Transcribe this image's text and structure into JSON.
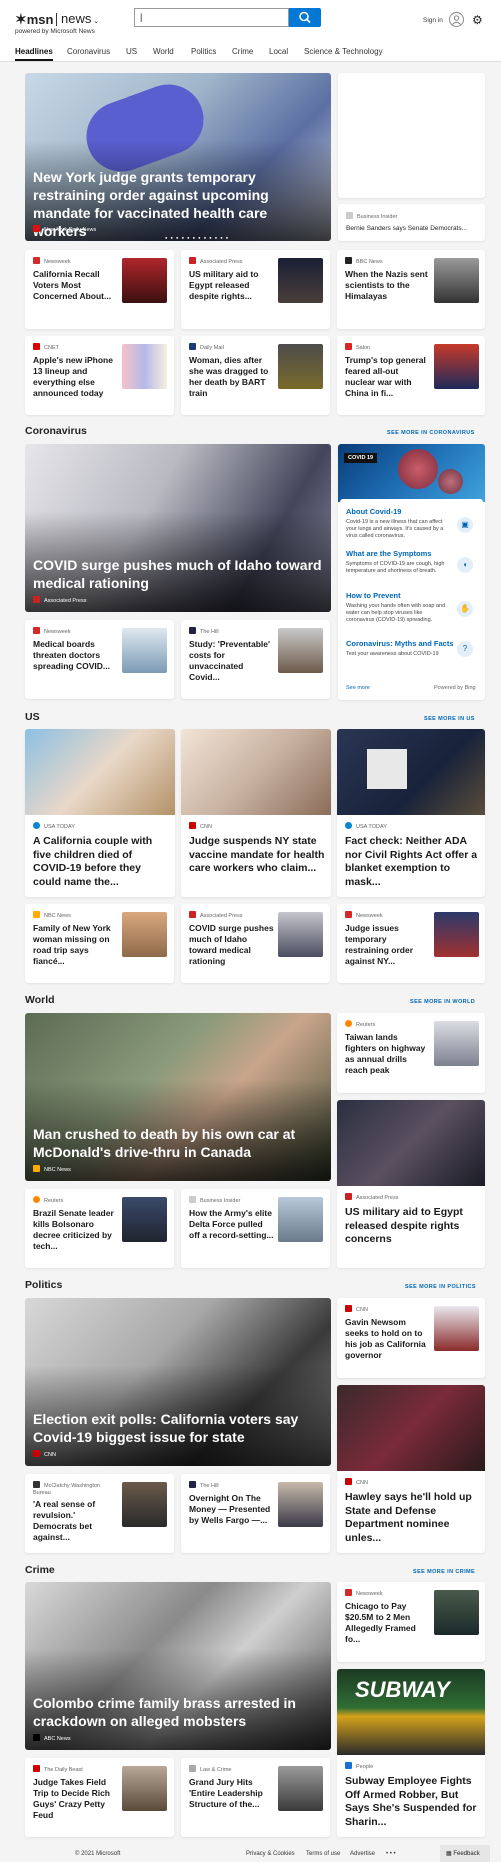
{
  "header": {
    "brand": "msn",
    "product": "news",
    "powered": "powered by Microsoft News",
    "search_value": "|",
    "signin": "Sign in"
  },
  "nav": [
    "Headlines",
    "Coronavirus",
    "US",
    "World",
    "Politics",
    "Crime",
    "Local",
    "Science & Technology"
  ],
  "headlines": {
    "hero": {
      "title": "New York judge grants temporary restraining order against upcoming mandate for vaccinated health care workers",
      "source": "New York Daily News"
    },
    "side": {
      "source": "Business Insider",
      "title": "Bernie Sanders says Senate Democrats..."
    },
    "cards": [
      {
        "source": "Newsweek",
        "title": "California Recall Voters Most Concerned About..."
      },
      {
        "source": "Associated Press",
        "title": "US military aid to Egypt released despite rights..."
      },
      {
        "source": "BBC News",
        "title": "When the Nazis sent scientists to the Himalayas"
      },
      {
        "source": "CNET",
        "title": "Apple's new iPhone 13 lineup and everything else announced today"
      },
      {
        "source": "Daily Mail",
        "title": "Woman, dies after she was dragged to her death by BART train"
      },
      {
        "source": "Salon",
        "title": "Trump's top general feared all-out nuclear war with China in fi..."
      }
    ]
  },
  "coronavirus": {
    "label": "Coronavirus",
    "more": "SEE MORE IN CORONAVIRUS",
    "hero": {
      "title": "COVID surge pushes much of Idaho toward medical rationing",
      "source": "Associated Press"
    },
    "panel": {
      "badge": "COVID 19",
      "items": [
        {
          "head": "About Covid-19",
          "text": "Covid-19 is a new illness that can affect your lungs and airways. It's caused by a virus called coronavirus."
        },
        {
          "head": "What are the Symptoms",
          "text": "Symptoms of COVID-19 are cough, high temperature and shortness of breath."
        },
        {
          "head": "How to Prevent",
          "text": "Washing your hands often with soap and water can help stop viruses like coronavirus (COVID-19) spreading."
        },
        {
          "head": "Coronavirus: Myths and Facts",
          "text": "Test your awareness about COVID-19"
        }
      ],
      "see_more": "See more",
      "powered": "Powered by Bing"
    },
    "cards": [
      {
        "source": "Newsweek",
        "title": "Medical boards threaten doctors spreading COVID..."
      },
      {
        "source": "The Hill",
        "title": "Study: 'Preventable' costs for unvaccinated Covid..."
      }
    ]
  },
  "us": {
    "label": "US",
    "more": "SEE MORE IN US",
    "tiles": [
      {
        "source": "USA TODAY",
        "title": "A California couple with five children died of COVID-19 before they could name the..."
      },
      {
        "source": "CNN",
        "title": "Judge suspends NY state vaccine mandate for health care workers who claim..."
      },
      {
        "source": "USA TODAY",
        "title": "Fact check: Neither ADA nor Civil Rights Act offer a blanket exemption to mask..."
      }
    ],
    "cards": [
      {
        "source": "NBC News",
        "title": "Family of New York woman missing on road trip says fiancé..."
      },
      {
        "source": "Associated Press",
        "title": "COVID surge pushes much of Idaho toward medical rationing"
      },
      {
        "source": "Newsweek",
        "title": "Judge issues temporary restraining order against NY..."
      }
    ]
  },
  "world": {
    "label": "World",
    "more": "SEE MORE IN WORLD",
    "hero": {
      "title": "Man crushed to death by his own car at McDonald's drive-thru in Canada",
      "source": "NBC News"
    },
    "side1": {
      "source": "Reuters",
      "title": "Taiwan lands fighters on highway as annual drills reach peak"
    },
    "side2": {
      "source": "Associated Press",
      "title": "US military aid to Egypt released despite rights concerns"
    },
    "cards": [
      {
        "source": "Reuters",
        "title": "Brazil Senate leader kills Bolsonaro decree criticized by tech..."
      },
      {
        "source": "Business Insider",
        "title": "How the Army's elite Delta Force pulled off a record-setting..."
      }
    ]
  },
  "politics": {
    "label": "Politics",
    "more": "SEE MORE IN POLITICS",
    "hero": {
      "title": "Election exit polls: California voters say Covid-19 biggest issue for state",
      "source": "CNN"
    },
    "side1": {
      "source": "CNN",
      "title": "Gavin Newsom seeks to hold on to his job as California governor"
    },
    "side2": {
      "source": "CNN",
      "title": "Hawley says he'll hold up State and Defense Department nominee unles..."
    },
    "cards": [
      {
        "source": "McClatchy Washington Bureau",
        "title": "'A real sense of revulsion.' Democrats bet against..."
      },
      {
        "source": "The Hill",
        "title": "Overnight On The Money — Presented by Wells Fargo —..."
      }
    ]
  },
  "crime": {
    "label": "Crime",
    "more": "SEE MORE IN CRIME",
    "hero": {
      "title": "Colombo crime family brass arrested in crackdown on alleged mobsters",
      "source": "ABC News"
    },
    "side1": {
      "source": "Newsweek",
      "title": "Chicago to Pay $20.5M to 2 Men Allegedly Framed fo..."
    },
    "side2": {
      "source": "People",
      "title": "Subway Employee Fights Off Armed Robber, But Says She's Suspended for Sharin..."
    },
    "cards": [
      {
        "source": "The Daily Beast",
        "title": "Judge Takes Field Trip to Decide Rich Guys' Crazy Petty Feud"
      },
      {
        "source": "Law & Crime",
        "title": "Grand Jury Hits 'Entire Leadership Structure of the..."
      }
    ]
  },
  "footer": {
    "copyright": "© 2021 Microsoft",
    "links": [
      "Privacy & Cookies",
      "Terms of use",
      "Advertise"
    ],
    "more": "• • •",
    "feedback": "Feedback"
  },
  "colors": {
    "accent": "#0067b8",
    "search_btn": "#0078d4"
  }
}
